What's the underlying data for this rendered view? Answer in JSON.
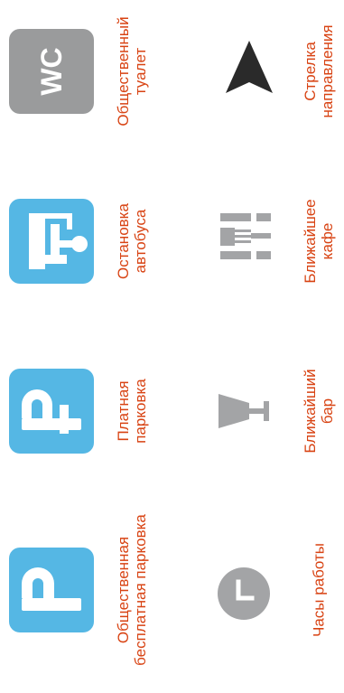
{
  "colors": {
    "tile_blue": "#55b7e4",
    "tile_gray": "#9a9b9c",
    "icon_gray": "#a3a4a6",
    "arrow_dark": "#2a2a2a",
    "label_orange": "#d84313"
  },
  "legend": {
    "free_parking": {
      "icon": "free-parking-icon",
      "line1": "Общественная",
      "line2": "бесплатная парковка"
    },
    "paid_parking": {
      "icon": "paid-parking-ruble-icon",
      "line1": "Платная",
      "line2": "парковка"
    },
    "bus_stop": {
      "icon": "bus-stop-icon",
      "line1": "Остановка",
      "line2": "автобуса"
    },
    "toilet": {
      "icon": "wc-icon",
      "icon_text": "WC",
      "line1": "Общественный",
      "line2": "туалет"
    },
    "hours": {
      "icon": "clock-icon",
      "line1": "Часы работы"
    },
    "bar": {
      "icon": "cocktail-glass-icon",
      "line1": "Ближайший",
      "line2": "бар"
    },
    "cafe": {
      "icon": "fork-knife-icon",
      "line1": "Ближайшее",
      "line2": "кафе"
    },
    "arrow": {
      "icon": "direction-arrow-icon",
      "line1": "Стрелка",
      "line2": "направления"
    }
  }
}
